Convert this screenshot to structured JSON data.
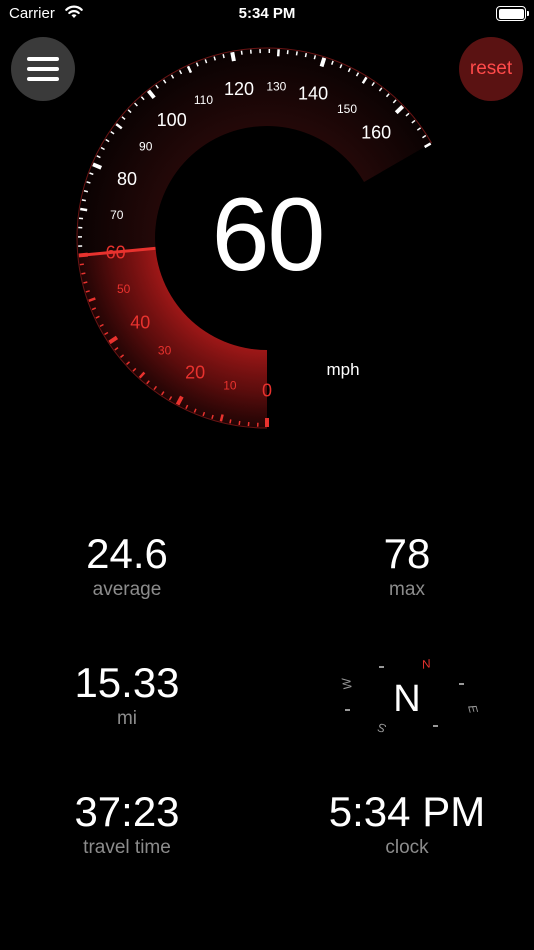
{
  "status_bar": {
    "carrier": "Carrier",
    "time": "5:34 PM"
  },
  "buttons": {
    "menu_icon": "hamburger-menu-icon",
    "reset_label": "reset"
  },
  "gauge": {
    "speed": "60",
    "unit": "mph",
    "needle_value": 60,
    "max_value": 170,
    "major_labels": [
      "0",
      "20",
      "40",
      "60",
      "80",
      "100",
      "120",
      "140",
      "160"
    ],
    "minor_labels": [
      "10",
      "30",
      "50",
      "70",
      "90",
      "110",
      "130",
      "150"
    ],
    "colors": {
      "active": "#e8322e",
      "inactive": "#ffffff"
    }
  },
  "stats": {
    "average": {
      "value": "24.6",
      "label": "average"
    },
    "max": {
      "value": "78",
      "label": "max"
    },
    "distance": {
      "value": "15.33",
      "label": "mi"
    },
    "travel_time": {
      "value": "37:23",
      "label": "travel time"
    },
    "clock": {
      "value": "5:34 PM",
      "label": "clock"
    }
  },
  "compass": {
    "heading": "N",
    "labels": [
      "N",
      "E",
      "S",
      "W"
    ]
  }
}
